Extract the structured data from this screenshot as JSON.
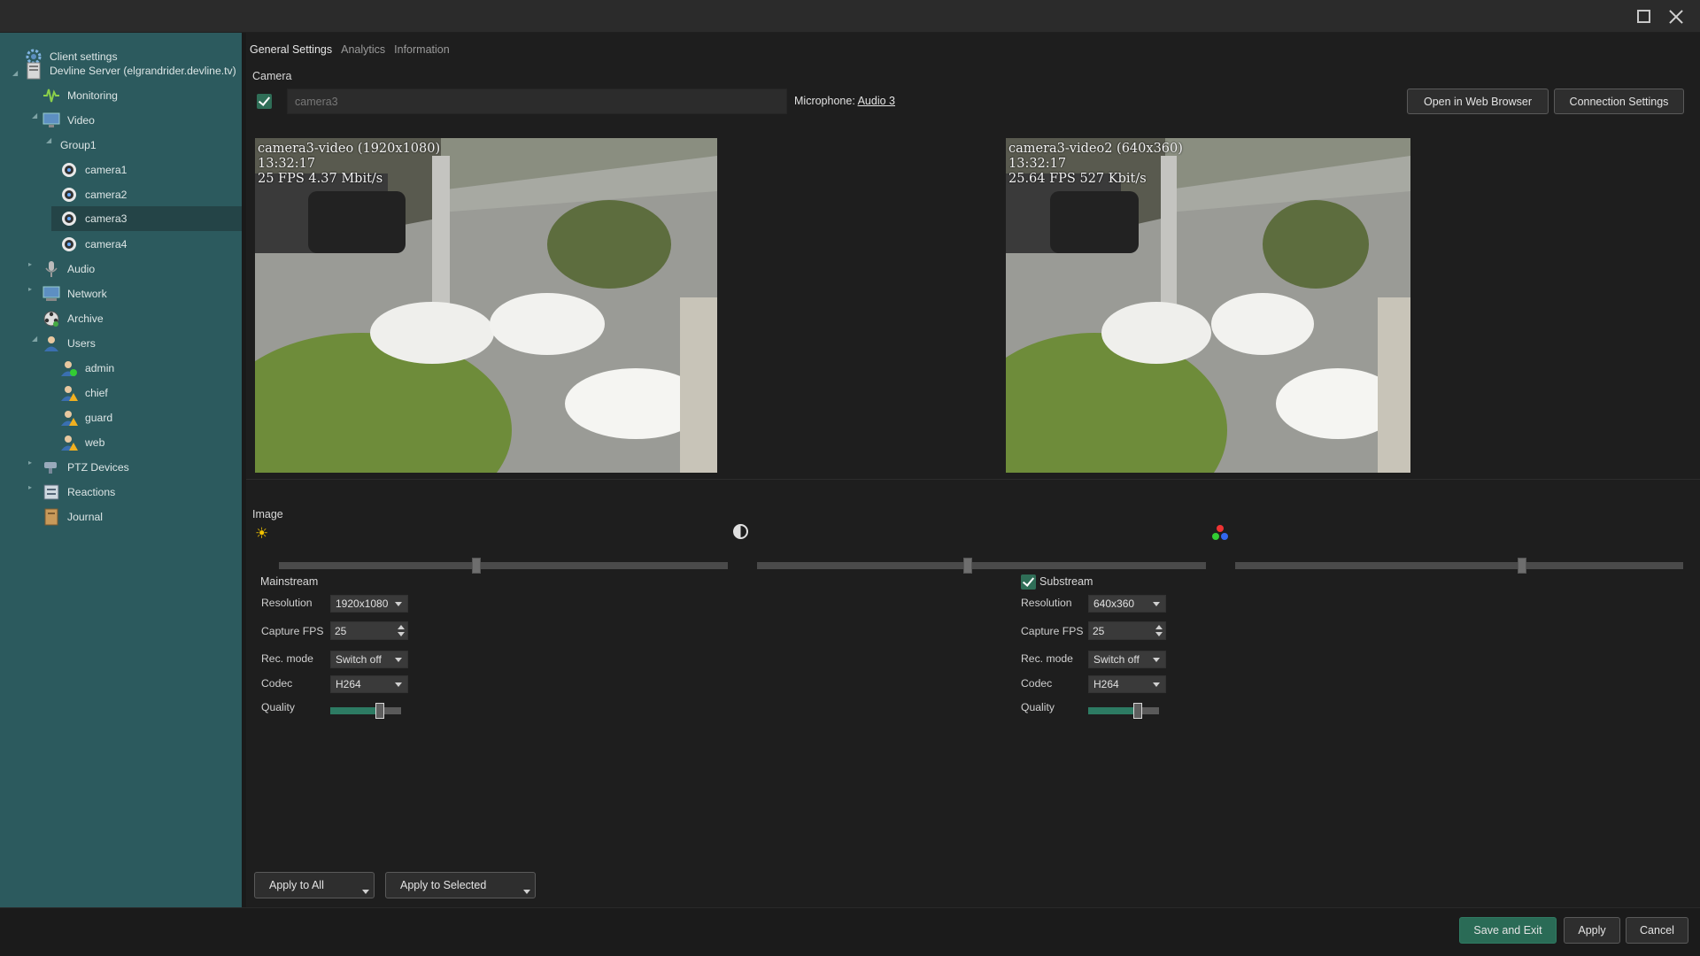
{
  "sidebar": {
    "items": [
      {
        "label": "Client settings",
        "icon": "gear-icon"
      },
      {
        "label": "Devline Server (elgrandrider.devline.tv)",
        "icon": "server-icon"
      },
      {
        "label": "Monitoring",
        "icon": "monitoring-icon"
      },
      {
        "label": "Video",
        "icon": "monitor-icon"
      },
      {
        "label": "Group1",
        "icon": ""
      },
      {
        "label": "camera1",
        "icon": "camera-icon"
      },
      {
        "label": "camera2",
        "icon": "camera-icon"
      },
      {
        "label": "camera3",
        "icon": "camera-icon"
      },
      {
        "label": "camera4",
        "icon": "camera-icon"
      },
      {
        "label": "Audio",
        "icon": "microphone-icon"
      },
      {
        "label": "Network",
        "icon": "network-icon"
      },
      {
        "label": "Archive",
        "icon": "archive-icon"
      },
      {
        "label": "Users",
        "icon": "users-icon"
      },
      {
        "label": "admin",
        "icon": "user-icon"
      },
      {
        "label": "chief",
        "icon": "user-icon"
      },
      {
        "label": "guard",
        "icon": "user-icon"
      },
      {
        "label": "web",
        "icon": "user-icon"
      },
      {
        "label": "PTZ Devices",
        "icon": "ptz-icon"
      },
      {
        "label": "Reactions",
        "icon": "reactions-icon"
      },
      {
        "label": "Journal",
        "icon": "journal-icon"
      }
    ],
    "selected": "camera3"
  },
  "tabs": [
    "General Settings",
    "Analytics",
    "Information"
  ],
  "camera": {
    "section_label": "Camera",
    "name_placeholder": "camera3",
    "microphone_label": "Microphone:",
    "microphone_value": "Audio 3",
    "open_browser_label": "Open in Web Browser",
    "connection_settings_label": "Connection Settings"
  },
  "previews": {
    "main": {
      "name": "camera3-video (1920x1080)",
      "time": "13:32:17",
      "stats": "25 FPS 4.37 Mbit/s"
    },
    "sub": {
      "name": "camera3-video2 (640x360)",
      "time": "13:32:17",
      "stats": "25.64 FPS 527 Kbit/s"
    }
  },
  "image": {
    "section_label": "Image",
    "brightness": 0.44,
    "contrast": 0.47,
    "saturation": 0.64
  },
  "mainstream": {
    "title": "Mainstream",
    "resolution_label": "Resolution",
    "resolution": "1920x1080",
    "fps_label": "Capture FPS",
    "fps": "25",
    "recmode_label": "Rec. mode",
    "recmode": "Switch off",
    "codec_label": "Codec",
    "codec": "H264",
    "quality_label": "Quality",
    "quality": 0.7
  },
  "substream": {
    "title": "Substream",
    "resolution_label": "Resolution",
    "resolution": "640x360",
    "fps_label": "Capture FPS",
    "fps": "25",
    "recmode_label": "Rec. mode",
    "recmode": "Switch off",
    "codec_label": "Codec",
    "codec": "H264",
    "quality_label": "Quality",
    "quality": 0.7
  },
  "actions": {
    "apply_all": "Apply to All",
    "apply_selected": "Apply to Selected",
    "save_exit": "Save and Exit",
    "apply": "Apply",
    "cancel": "Cancel"
  },
  "colors": {
    "sidebar": "#2c5a5e",
    "accent": "#2a6b56",
    "selected_row": "#244447"
  }
}
